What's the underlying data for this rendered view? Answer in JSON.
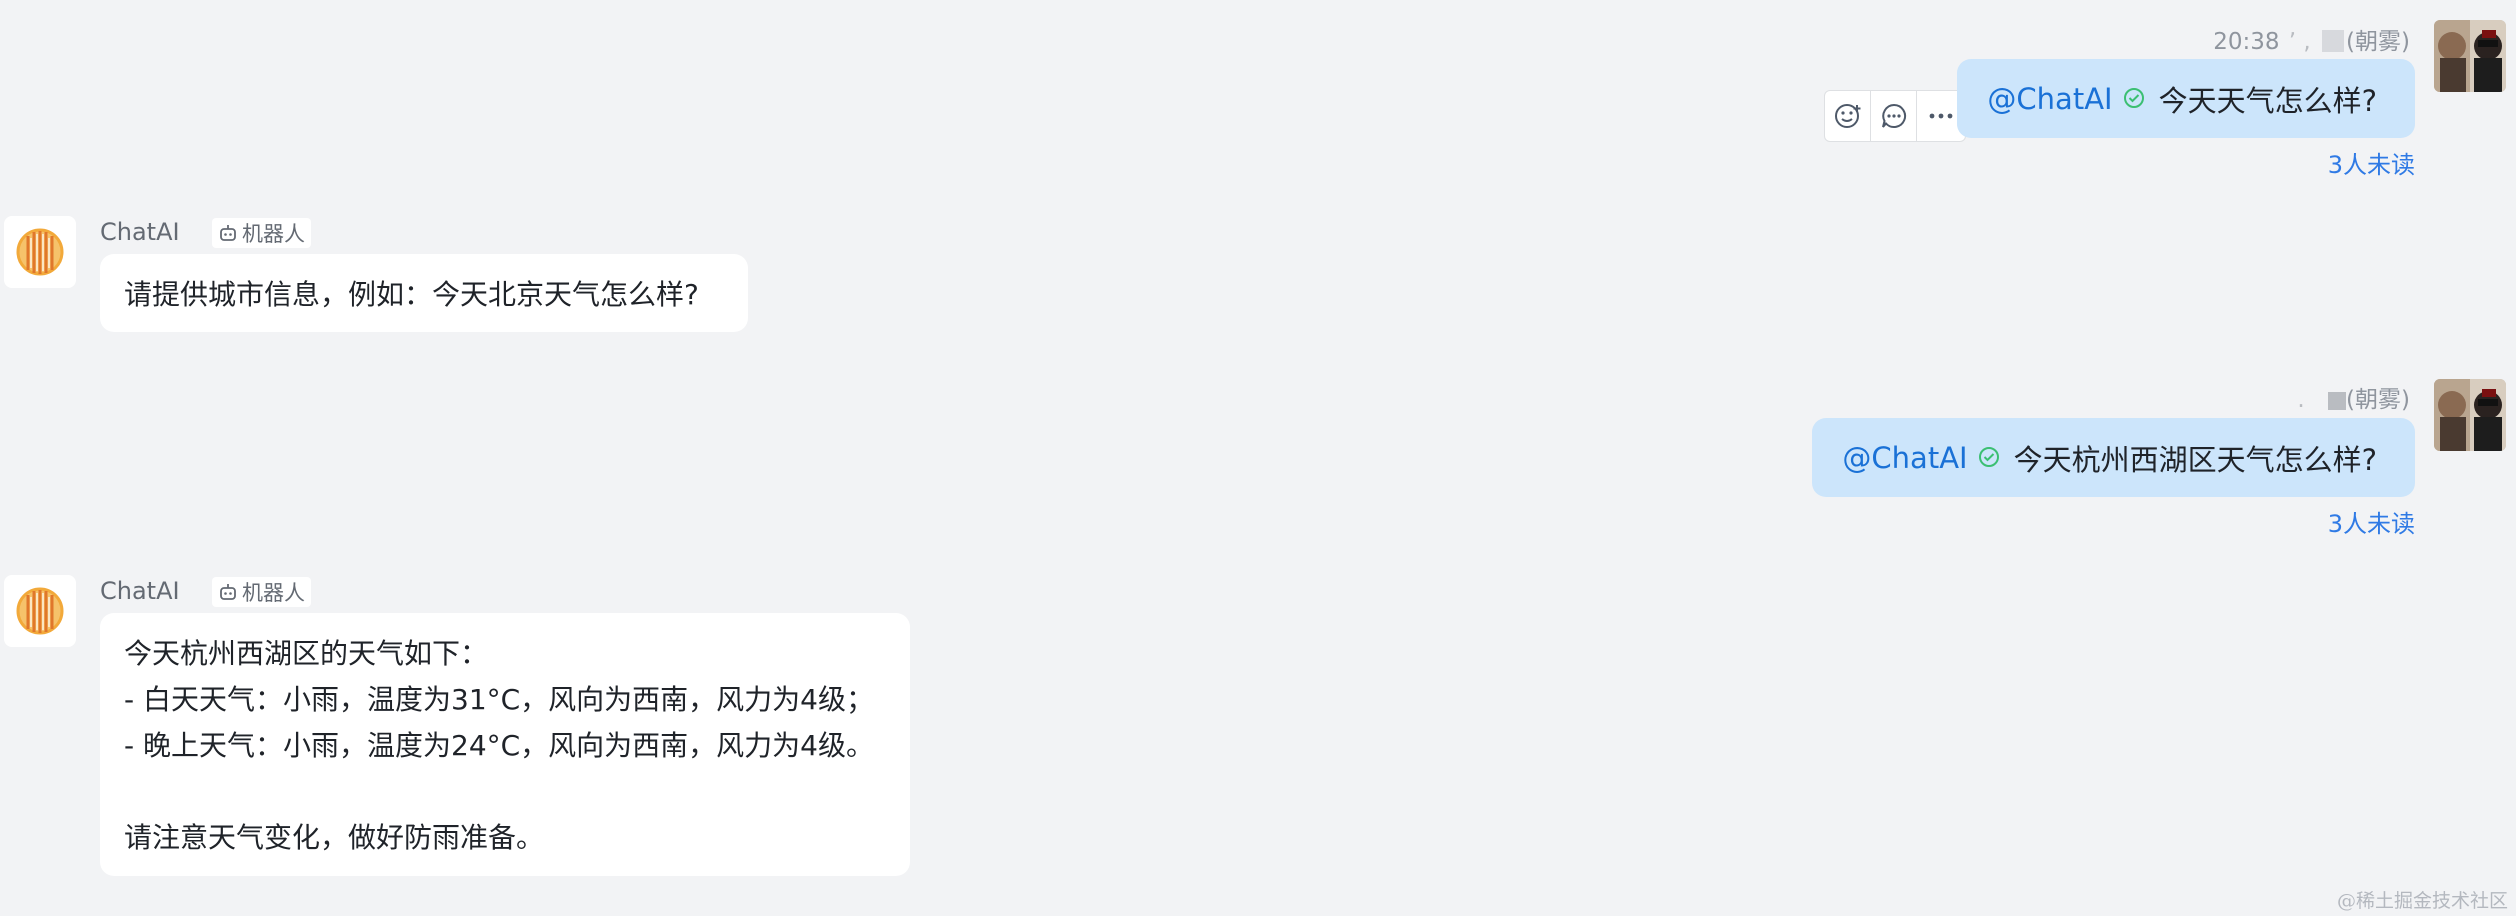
{
  "messages": {
    "out1": {
      "time": "20:38",
      "sender": "(朝雾)",
      "mention": "@ChatAI",
      "text": "今天天气怎么样?",
      "read_status": "3人未读"
    },
    "in1": {
      "sender": "ChatAI",
      "tag": "机器人",
      "text": "请提供城市信息，例如：今天北京天气怎么样?"
    },
    "out2": {
      "sender": "(朝雾)",
      "mention": "@ChatAI",
      "text": "今天杭州西湖区天气怎么样?",
      "read_status": "3人未读"
    },
    "in2": {
      "sender": "ChatAI",
      "tag": "机器人",
      "lines": [
        "今天杭州西湖区的天气如下：",
        "- 白天天气：小雨，温度为31°C，风向为西南，风力为4级；",
        "- 晚上天气：小雨，温度为24°C，风向为西南，风力为4级。",
        "",
        "请注意天气变化，做好防雨准备。"
      ]
    }
  },
  "watermark": "@稀土掘金技术社区",
  "icons": {
    "check": "verified-check-icon",
    "emoji": "emoji-reaction-icon",
    "reply": "reply-bubble-icon",
    "more": "more-dots-icon",
    "robot": "robot-icon"
  },
  "colors": {
    "background": "#f2f3f5",
    "bubble_out": "#cce5fb",
    "bubble_in": "#ffffff",
    "mention": "#1a71d6",
    "read_status": "#2f7ae5",
    "check": "#3bbf72"
  }
}
